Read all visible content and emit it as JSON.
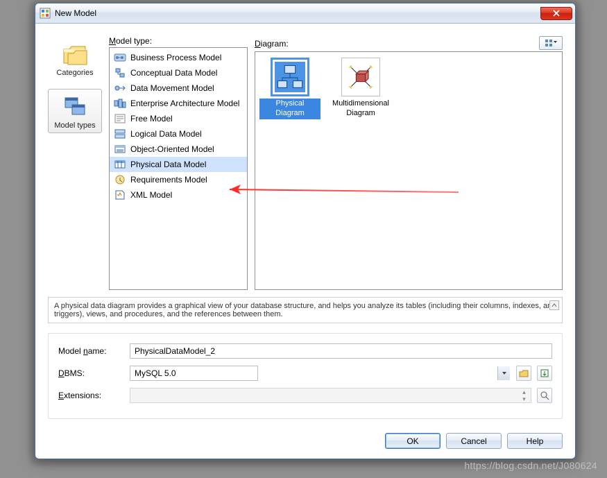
{
  "window": {
    "title": "New Model"
  },
  "sidebar": {
    "items": [
      {
        "label": "Categories"
      },
      {
        "label": "Model types"
      }
    ],
    "selected": 1
  },
  "types": {
    "label": "Model type:",
    "items": [
      "Business Process Model",
      "Conceptual Data Model",
      "Data Movement Model",
      "Enterprise Architecture Model",
      "Free Model",
      "Logical Data Model",
      "Object-Oriented Model",
      "Physical Data Model",
      "Requirements Model",
      "XML Model"
    ],
    "selected": 7
  },
  "diagram": {
    "label": "Diagram:",
    "items": [
      {
        "label": "Physical Diagram"
      },
      {
        "label": "Multidimensional Diagram"
      }
    ],
    "selected": 0
  },
  "description": "A physical data diagram provides a graphical view of your database structure, and helps you analyze its tables (including their columns, indexes, and triggers), views, and procedures, and the references between them.",
  "form": {
    "name_label": "Model name:",
    "name_value": "PhysicalDataModel_2",
    "dbms_label": "DBMS:",
    "dbms_value": "MySQL 5.0",
    "ext_label": "Extensions:"
  },
  "buttons": {
    "ok": "OK",
    "cancel": "Cancel",
    "help": "Help"
  },
  "watermark": "https://blog.csdn.net/J080624"
}
